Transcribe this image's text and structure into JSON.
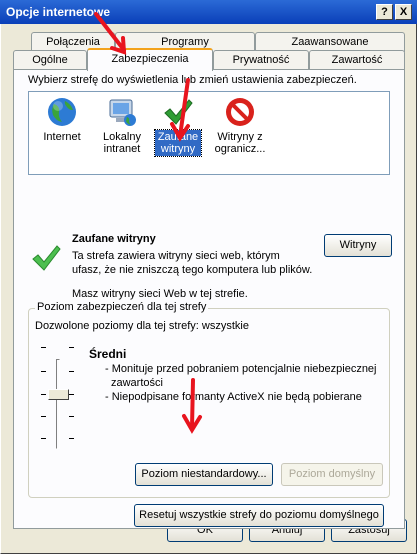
{
  "window": {
    "title": "Opcje internetowe",
    "help_label": "?",
    "close_label": "X"
  },
  "tabs": {
    "row1": [
      "Połączenia",
      "Programy",
      "Zaawansowane"
    ],
    "row2": [
      "Ogólne",
      "Zabezpieczenia",
      "Prywatność",
      "Zawartość"
    ],
    "active": "Zabezpieczenia"
  },
  "zones": {
    "instruction": "Wybierz strefę do wyświetlenia lub zmień ustawienia zabezpieczeń.",
    "items": [
      {
        "label": "Internet",
        "icon": "globe-icon"
      },
      {
        "label": "Lokalny intranet",
        "icon": "computer-globe-icon"
      },
      {
        "label": "Zaufane witryny",
        "icon": "green-check-icon",
        "selected": true
      },
      {
        "label": "Witryny z ogranicz...",
        "icon": "red-no-entry-icon"
      }
    ]
  },
  "zone_detail": {
    "title": "Zaufane witryny",
    "description_line1": "Ta strefa zawiera witryny sieci web, którym",
    "description_line2": "ufasz, że nie zniszczą tego komputera lub plików.",
    "status": "Masz witryny sieci Web w tej strefie.",
    "sites_button": "Witryny"
  },
  "security_level": {
    "legend": "Poziom zabezpieczeń dla tej strefy",
    "allowed": "Dozwolone poziomy dla tej strefy: wszystkie",
    "level_name": "Średni",
    "bullet1_line1": "- Monituje przed pobraniem potencjalnie niebezpiecznej",
    "bullet1_line2": "zawartości",
    "bullet2": "- Niepodpisane formanty ActiveX nie będą pobierane",
    "custom_button": "Poziom niestandardowy...",
    "default_button": "Poziom domyślny",
    "reset_button": "Resetuj wszystkie strefy do poziomu domyślnego"
  },
  "dialog_buttons": {
    "ok": "OK",
    "cancel": "Anuluj",
    "apply": "Zastosuj"
  },
  "colors": {
    "title_bar": "#0a3fb8",
    "selection": "#316ac5",
    "annotation_arrow": "#e8141e",
    "tab_highlight": "#f3a21a"
  }
}
